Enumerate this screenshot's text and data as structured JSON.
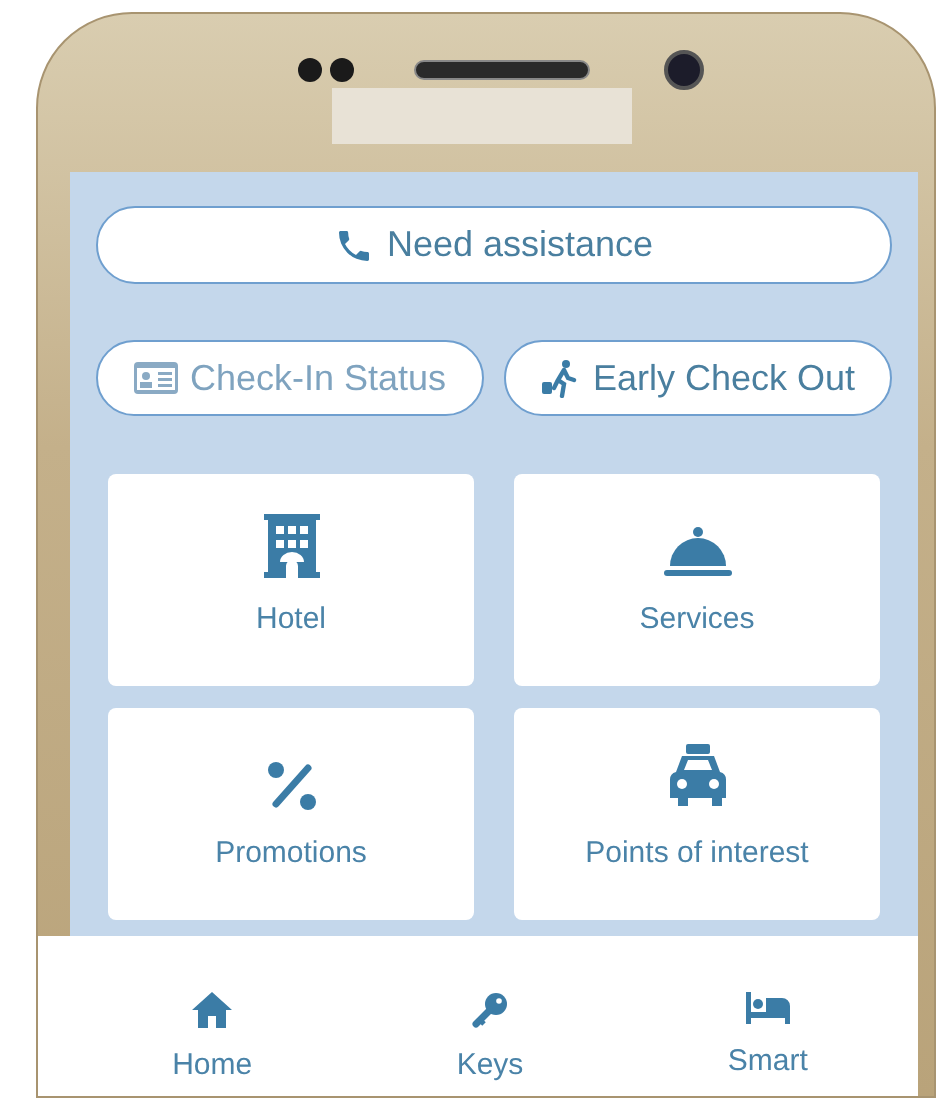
{
  "assistance_button": {
    "label": "Need assistance"
  },
  "actions": [
    {
      "kind": "checkin",
      "label": "Check-In Status",
      "disabled": true
    },
    {
      "kind": "checkout",
      "label": "Early Check Out",
      "disabled": false
    }
  ],
  "tiles": [
    {
      "kind": "hotel",
      "label": "Hotel"
    },
    {
      "kind": "services",
      "label": "Services"
    },
    {
      "kind": "promotions",
      "label": "Promotions"
    },
    {
      "kind": "taxi",
      "label": "Points of interest"
    }
  ],
  "bottom_nav": [
    {
      "kind": "home",
      "label": "Home"
    },
    {
      "kind": "key",
      "label": "Keys"
    },
    {
      "kind": "bed",
      "label": "Smart"
    }
  ]
}
